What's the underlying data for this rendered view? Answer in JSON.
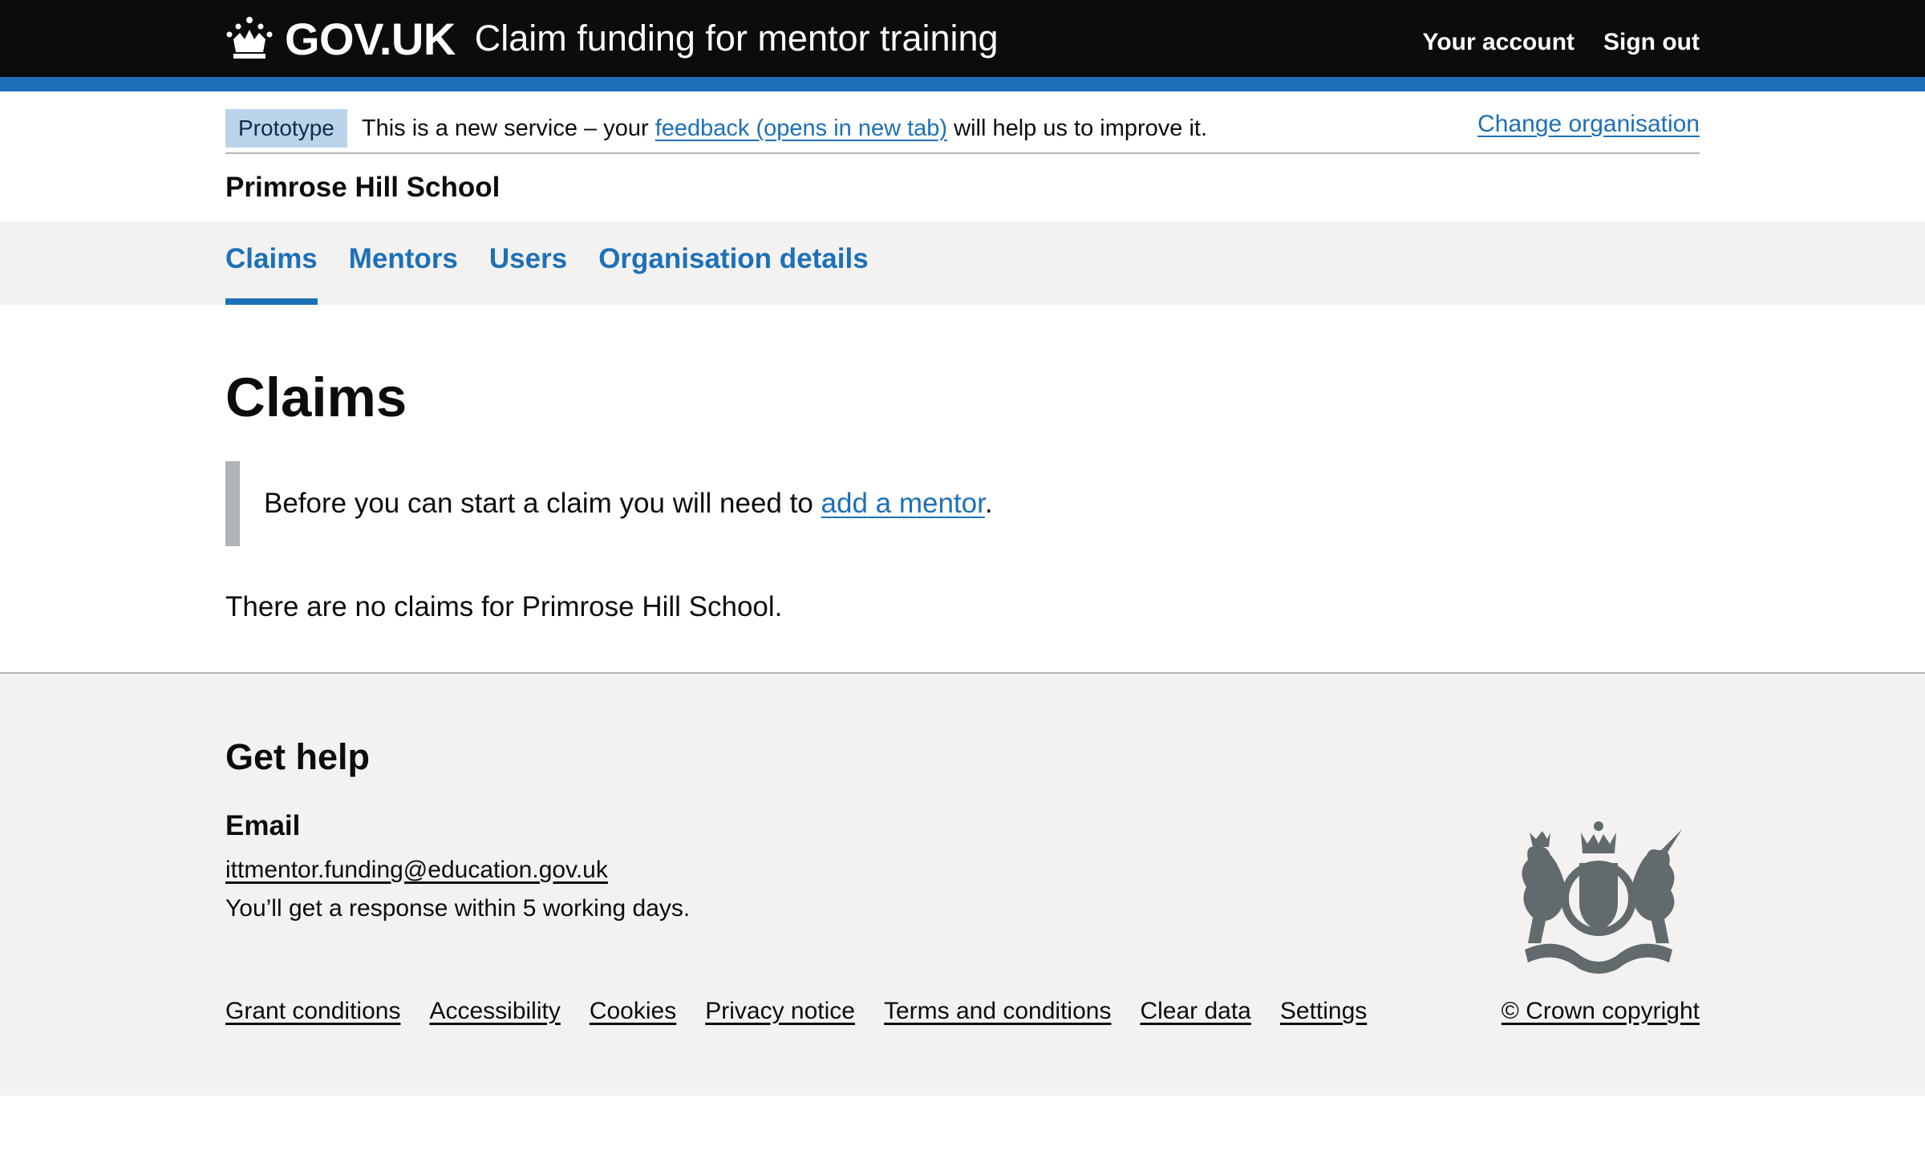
{
  "header": {
    "logotype": "GOV.UK",
    "service_name": "Claim funding for mentor training",
    "your_account": "Your account",
    "sign_out": "Sign out"
  },
  "phase_banner": {
    "tag": "Prototype",
    "text_before": "This is a new service – your ",
    "feedback_link": "feedback (opens in new tab)",
    "text_after": " will help us to improve it."
  },
  "org_bar": {
    "name": "Primrose Hill School",
    "change_link": "Change organisation"
  },
  "nav": {
    "items": [
      {
        "label": "Claims",
        "active": true
      },
      {
        "label": "Mentors",
        "active": false
      },
      {
        "label": "Users",
        "active": false
      },
      {
        "label": "Organisation details",
        "active": false
      }
    ]
  },
  "main": {
    "title": "Claims",
    "inset_before": "Before you can start a claim you will need to ",
    "inset_link": "add a mentor",
    "inset_after": ".",
    "empty_text": "There are no claims for Primrose Hill School."
  },
  "footer": {
    "heading": "Get help",
    "email_heading": "Email",
    "email": "ittmentor.funding@education.gov.uk",
    "response": "You’ll get a response within 5 working days.",
    "links": [
      "Grant conditions",
      "Accessibility",
      "Cookies",
      "Privacy notice",
      "Terms and conditions",
      "Clear data",
      "Settings"
    ],
    "copyright": "© Crown copyright"
  },
  "colors": {
    "header_bg": "#0b0c0c",
    "brand_blue": "#1d70b8",
    "footer_bg": "#f3f2f1",
    "tag_bg": "#bbd4ea"
  }
}
